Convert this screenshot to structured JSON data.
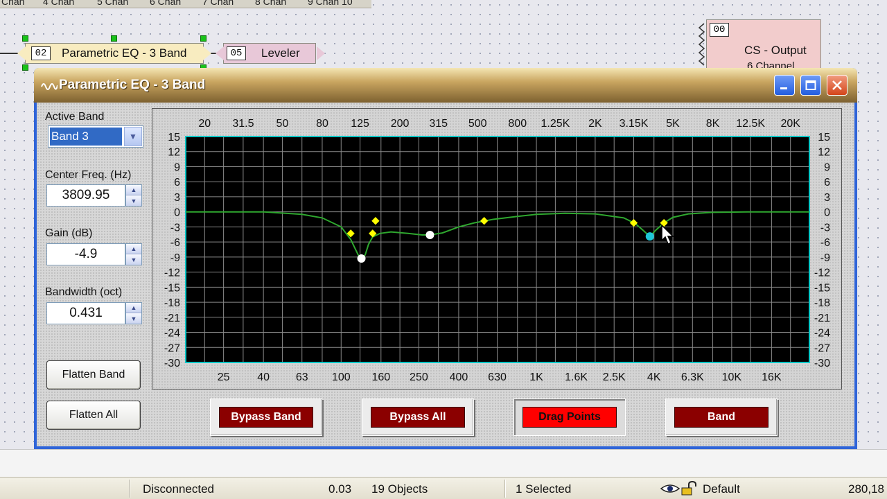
{
  "window_title": "Parametric EQ - 3 Band",
  "channel_tabs": [
    "Chan",
    "4 Chan",
    "5 Chan",
    "6 Chan",
    "7 Chan",
    "8 Chan",
    "9 Chan 10"
  ],
  "canvas_blocks": {
    "peq": {
      "pin": "02",
      "label": "Parametric EQ - 3 Band"
    },
    "leveler": {
      "pin": "05",
      "label": "Leveler"
    },
    "output": {
      "pin": "00",
      "label": "CS - Output",
      "sublabel": "6 Channel"
    }
  },
  "controls": {
    "active_band_label": "Active Band",
    "active_band_value": "Band 3",
    "center_freq_label": "Center Freq. (Hz)",
    "center_freq_value": "3809.95",
    "gain_label": "Gain (dB)",
    "gain_value": "-4.9",
    "bandwidth_label": "Bandwidth (oct)",
    "bandwidth_value": "0.431",
    "flatten_band": "Flatten Band",
    "flatten_all": "Flatten All"
  },
  "buttons": {
    "bypass_band": "Bypass Band",
    "bypass_all": "Bypass All",
    "drag_points": "Drag Points",
    "band": "Band"
  },
  "colors": {
    "graph_bg": "#000000",
    "grid": "#8a8a8a",
    "graph_border": "#00c8c8",
    "curve": "#2fa82f",
    "handle_yellow": "#ffff00",
    "handle_white": "#ffffff",
    "handle_active": "#1ec8d8",
    "button_dark_red": "#8b0000",
    "button_active_red": "#ff0000",
    "titlebar": "#c9a560"
  },
  "chart_data": {
    "type": "line",
    "x_scale": "log",
    "xlim": [
      16,
      25000
    ],
    "ylim": [
      -30,
      15
    ],
    "y_ticks": [
      15,
      12,
      9,
      6,
      3,
      0,
      -3,
      -6,
      -9,
      -12,
      -15,
      -18,
      -21,
      -24,
      -27,
      -30
    ],
    "top_ticks": [
      {
        "f": 20,
        "label": "20"
      },
      {
        "f": 31.5,
        "label": "31.5"
      },
      {
        "f": 50,
        "label": "50"
      },
      {
        "f": 80,
        "label": "80"
      },
      {
        "f": 125,
        "label": "125"
      },
      {
        "f": 200,
        "label": "200"
      },
      {
        "f": 315,
        "label": "315"
      },
      {
        "f": 500,
        "label": "500"
      },
      {
        "f": 800,
        "label": "800"
      },
      {
        "f": 1250,
        "label": "1.25K"
      },
      {
        "f": 2000,
        "label": "2K"
      },
      {
        "f": 3150,
        "label": "3.15K"
      },
      {
        "f": 5000,
        "label": "5K"
      },
      {
        "f": 8000,
        "label": "8K"
      },
      {
        "f": 12500,
        "label": "12.5K"
      },
      {
        "f": 20000,
        "label": "20K"
      }
    ],
    "bottom_ticks": [
      {
        "f": 25,
        "label": "25"
      },
      {
        "f": 40,
        "label": "40"
      },
      {
        "f": 63,
        "label": "63"
      },
      {
        "f": 100,
        "label": "100"
      },
      {
        "f": 160,
        "label": "160"
      },
      {
        "f": 250,
        "label": "250"
      },
      {
        "f": 400,
        "label": "400"
      },
      {
        "f": 630,
        "label": "630"
      },
      {
        "f": 1000,
        "label": "1K"
      },
      {
        "f": 1600,
        "label": "1.6K"
      },
      {
        "f": 2500,
        "label": "2.5K"
      },
      {
        "f": 4000,
        "label": "4K"
      },
      {
        "f": 6300,
        "label": "6.3K"
      },
      {
        "f": 10000,
        "label": "10K"
      },
      {
        "f": 16000,
        "label": "16K"
      }
    ],
    "curve": [
      [
        16,
        0
      ],
      [
        40,
        0
      ],
      [
        63,
        -0.5
      ],
      [
        80,
        -1.2
      ],
      [
        100,
        -3
      ],
      [
        112,
        -5.5
      ],
      [
        122,
        -8.5
      ],
      [
        128,
        -9.5
      ],
      [
        133,
        -8.5
      ],
      [
        138,
        -6.5
      ],
      [
        145,
        -5
      ],
      [
        158,
        -4.3
      ],
      [
        180,
        -4
      ],
      [
        220,
        -4.3
      ],
      [
        260,
        -4.6
      ],
      [
        285,
        -4.6
      ],
      [
        330,
        -4.2
      ],
      [
        400,
        -3
      ],
      [
        480,
        -2.2
      ],
      [
        600,
        -1.5
      ],
      [
        800,
        -0.9
      ],
      [
        1000,
        -0.5
      ],
      [
        1400,
        -0.3
      ],
      [
        2000,
        -0.4
      ],
      [
        2800,
        -1.2
      ],
      [
        3200,
        -2.3
      ],
      [
        3500,
        -3.6
      ],
      [
        3810,
        -4.9
      ],
      [
        4100,
        -3.6
      ],
      [
        4500,
        -2.2
      ],
      [
        5000,
        -1.1
      ],
      [
        6000,
        -0.4
      ],
      [
        8000,
        -0.1
      ],
      [
        12000,
        0
      ],
      [
        25000,
        0
      ]
    ],
    "handles": [
      {
        "f": 112,
        "g": -4.3,
        "kind": "yellow"
      },
      {
        "f": 127,
        "g": -9.3,
        "kind": "white"
      },
      {
        "f": 145,
        "g": -4.3,
        "kind": "yellow"
      },
      {
        "f": 150,
        "g": -1.8,
        "kind": "yellow"
      },
      {
        "f": 285,
        "g": -4.6,
        "kind": "white"
      },
      {
        "f": 540,
        "g": -1.8,
        "kind": "yellow"
      },
      {
        "f": 3150,
        "g": -2.2,
        "kind": "yellow"
      },
      {
        "f": 3810,
        "g": -4.9,
        "kind": "active"
      },
      {
        "f": 4500,
        "g": -2.2,
        "kind": "yellow"
      }
    ]
  },
  "status": {
    "connection": "Disconnected",
    "version": "0.03",
    "objects": "19 Objects",
    "selected": "1 Selected",
    "preset": "Default",
    "coords": "280,18"
  }
}
